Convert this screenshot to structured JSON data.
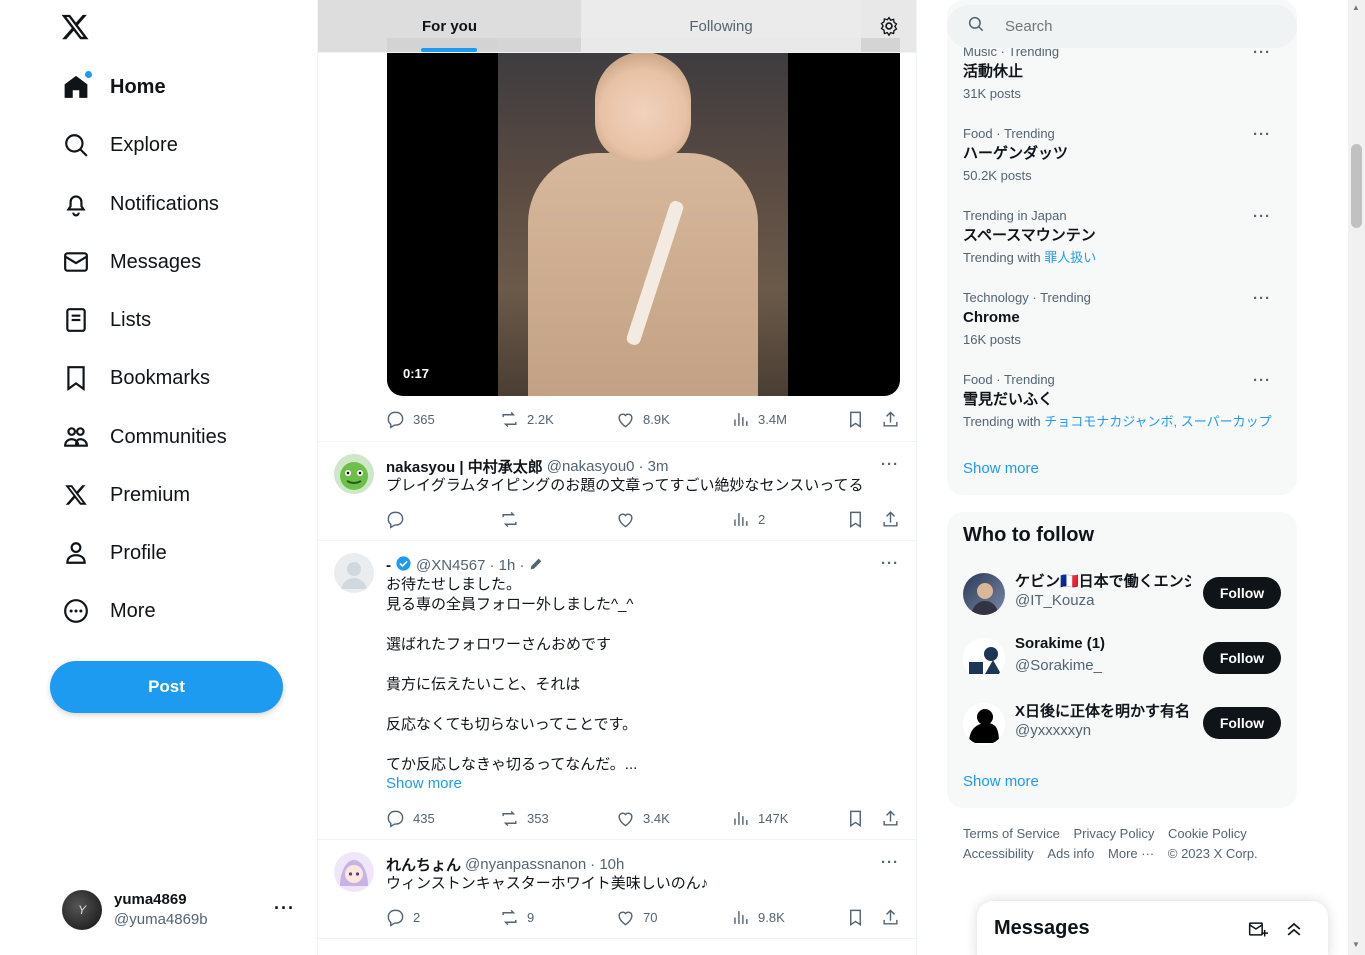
{
  "nav": {
    "items": [
      {
        "label": "Home",
        "icon": "home-icon"
      },
      {
        "label": "Explore",
        "icon": "search-icon"
      },
      {
        "label": "Notifications",
        "icon": "bell-icon"
      },
      {
        "label": "Messages",
        "icon": "envelope-icon"
      },
      {
        "label": "Lists",
        "icon": "list-icon"
      },
      {
        "label": "Bookmarks",
        "icon": "bookmark-icon"
      },
      {
        "label": "Communities",
        "icon": "people-icon"
      },
      {
        "label": "Premium",
        "icon": "x-logo-icon"
      },
      {
        "label": "Profile",
        "icon": "person-icon"
      },
      {
        "label": "More",
        "icon": "more-circle-icon"
      }
    ],
    "post_label": "Post"
  },
  "account": {
    "name": "yuma4869",
    "handle": "@yuma4869b"
  },
  "tabs": {
    "for_you": "For you",
    "following": "Following"
  },
  "feed": {
    "video_tweet": {
      "duration": "0:17",
      "replies": "365",
      "reposts": "2.2K",
      "likes": "8.9K",
      "views": "3.4M"
    },
    "tweets": [
      {
        "name": "nakasyou | 中村承太郎",
        "handle": "@nakasyou0",
        "time": "· 3m",
        "text": "プレイグラムタイピングのお題の文章ってすごい絶妙なセンスいってる",
        "replies": "",
        "reposts": "",
        "likes": "",
        "views": "2"
      },
      {
        "name": "-",
        "handle": "@XN4567",
        "time": "· 1h ·",
        "text": "お待たせしました。\n見る専の全員フォロー外しました^_^\n\n選ばれたフォロワーさんおめです\n\n貴方に伝えたいこと、それは\n\n反応なくても切らないってことです。\n\nてか反応しなきゃ切るってなんだ。...",
        "show_more": "Show more",
        "replies": "435",
        "reposts": "353",
        "likes": "3.4K",
        "views": "147K"
      },
      {
        "name": "れんちょん",
        "handle": "@nyanpassnanon",
        "time": "· 10h",
        "text": "ウィンストンキャスターホワイト美味しいのん♪",
        "replies": "2",
        "reposts": "9",
        "likes": "70",
        "views": "9.8K"
      }
    ]
  },
  "search": {
    "placeholder": "Search"
  },
  "trends": {
    "items": [
      {
        "category": "Music · Trending",
        "name": "活動休止",
        "sub": "31K posts"
      },
      {
        "category": "Food · Trending",
        "name": "ハーゲンダッツ",
        "sub": "50.2K posts"
      },
      {
        "category": "Trending in Japan",
        "name": "スペースマウンテン",
        "sub_prefix": "Trending with",
        "sub_link": "罪人扱い"
      },
      {
        "category": "Technology · Trending",
        "name": "Chrome",
        "sub": "16K posts"
      },
      {
        "category": "Food · Trending",
        "name": "雪見だいふく",
        "sub_prefix": "Trending with",
        "sub_link": "チョコモナカジャンボ, スーパーカップ"
      }
    ],
    "show_more": "Show more"
  },
  "who_to_follow": {
    "title": "Who to follow",
    "items": [
      {
        "name": "ケビン🇫🇷日本で働くエンジ",
        "handle": "@IT_Kouza",
        "button": "Follow"
      },
      {
        "name": "Sorakime (1)",
        "handle": "@Sorakime_",
        "button": "Follow"
      },
      {
        "name": "X日後に正体を明かす有名",
        "handle": "@yxxxxxyn",
        "button": "Follow"
      }
    ],
    "show_more": "Show more"
  },
  "footer": {
    "links": [
      "Terms of Service",
      "Privacy Policy",
      "Cookie Policy",
      "Accessibility",
      "Ads info",
      "More ···",
      "© 2023 X Corp."
    ]
  },
  "messages_drawer": {
    "title": "Messages"
  },
  "colors": {
    "accent": "#1d9bf0",
    "text": "#0f1419",
    "muted": "#536471"
  }
}
